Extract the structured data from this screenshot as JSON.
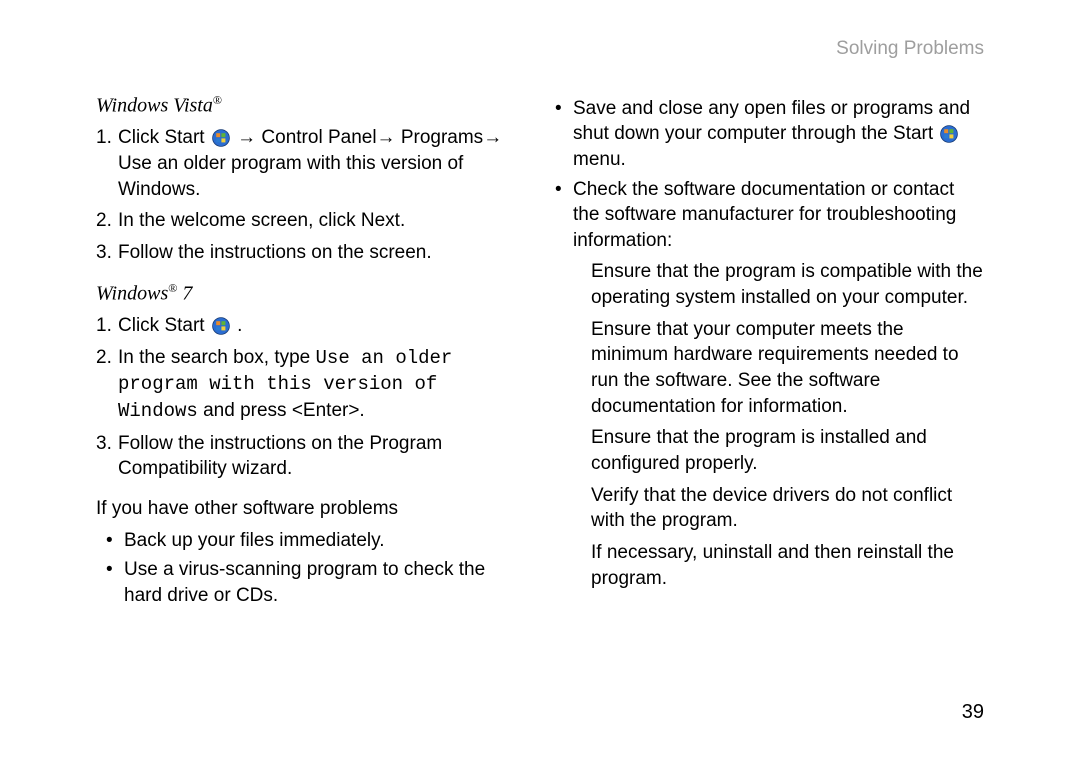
{
  "header": {
    "title": "Solving Problems"
  },
  "page_number": "39",
  "os_vista_heading": "Windows Vista",
  "os_vista_reg": "®",
  "vista_step_1": {
    "num": "1.",
    "a": "Click ",
    "b": "Start ",
    "c": " → ",
    "d": "Control Panel",
    "e": "→ ",
    "f": "Programs",
    "g": "→ ",
    "h": "Use an older program with this version of Windows",
    "i": "."
  },
  "vista_step_2": {
    "num": "2.",
    "a": "In the welcome screen, click ",
    "b": "Next",
    "c": "."
  },
  "vista_step_3": {
    "num": "3.",
    "a": "Follow the instructions on the screen."
  },
  "os_win7_heading": "Windows",
  "os_win7_reg": "®",
  "os_win7_ver": " 7",
  "win7_step_1": {
    "num": "1.",
    "a": "Click ",
    "b": "Start ",
    "c": " ."
  },
  "win7_step_2": {
    "num": "2.",
    "a": "In the search box, type ",
    "b": "Use an older program with this version of Windows",
    "c": " and press <Enter>."
  },
  "win7_step_3": {
    "num": "3.",
    "a": "Follow the instructions on the ",
    "b": "Program Compatibility",
    "c": " wizard."
  },
  "other_problems_heading": "If you have other software problems",
  "bul_backup": "Back up your files immediately.",
  "bul_virus": {
    "a": "Use a virus",
    "b": "-",
    "c": "scanning program to check the hard drive or CDs."
  },
  "bul_save": {
    "a": "Save and close any open files or programs and shut down your computer through the Start ",
    "b": "  menu."
  },
  "bul_docs": "Check the software documentation or contact the software manufacturer for troubleshooting information:",
  "sub1": "Ensure that the program is compatible with the operating system installed on your computer.",
  "sub2": "Ensure that your computer meets the minimum hardware requirements needed to run the software. See the software documentation for information.",
  "sub3": "Ensure that the program is installed and configured properly.",
  "sub4": "Verify that the device drivers do not conflict with the program.",
  "sub5": "If necessary, uninstall and then reinstall the program.",
  "bullet_glyph": "•"
}
